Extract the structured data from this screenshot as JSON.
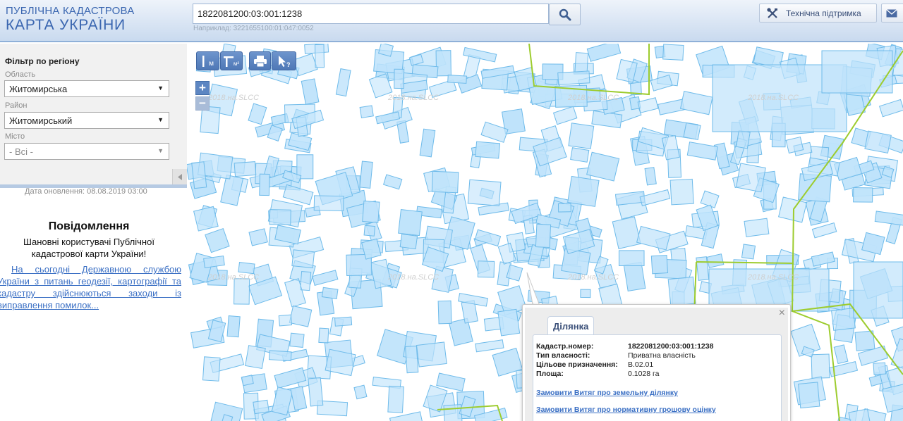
{
  "header": {
    "logo_line1": "ПУБЛІЧНА КАДАСТРОВА",
    "logo_line2": "КАРТА УКРАЇНИ",
    "search_value": "1822081200:03:001:1238",
    "search_hint": "Наприклад: 3221655100:01:047:0052",
    "support_label": "Технічна підтримка",
    "icons": {
      "search": "search-icon",
      "support": "tools-icon",
      "mail": "mail-icon"
    }
  },
  "filter": {
    "title": "Фільтр по регіону",
    "fields": [
      {
        "label": "Область",
        "value": "Житомирська"
      },
      {
        "label": "Район",
        "value": "Житомирський"
      },
      {
        "label": "Місто",
        "value": "- Всі -"
      }
    ]
  },
  "update_date": "Дата оновлення: 08.08.2019 03:00",
  "message": {
    "title": "Повідомлення",
    "greeting": "Шановні користувачі Публічної кадастрової карти України!",
    "link_text": "На сьогодні Державною службою України з питань геодезії, картографії та кадастру здійснюються заходи із виправлення помилок..."
  },
  "map_tools": {
    "measure_length": "м",
    "measure_area": "м²",
    "print_icon": "printer-icon",
    "identify_icon": "cursor-question-icon",
    "zoom_in": "+",
    "zoom_out": "−",
    "watermark": "2018.на.SLCC"
  },
  "popup": {
    "tab": "Ділянка",
    "rows": [
      {
        "key": "Кадастр.номер:",
        "value": "1822081200:03:001:1238"
      },
      {
        "key": "Тип власності:",
        "value": "Приватна власність"
      },
      {
        "key": "Цільове призначення:",
        "value": "В.02.01"
      },
      {
        "key": "Площа:",
        "value": "0.1028 га"
      }
    ],
    "link1": "Замовити Витяг про земельну ділянку",
    "link2": "Замовити Витяг про нормативну грошову оцінку",
    "close": "×"
  },
  "colors": {
    "parcel_fill": "#bfe3fb",
    "parcel_stroke": "#6fbbea",
    "boundary": "#9dcc2e",
    "brand": "#3a66b0"
  }
}
